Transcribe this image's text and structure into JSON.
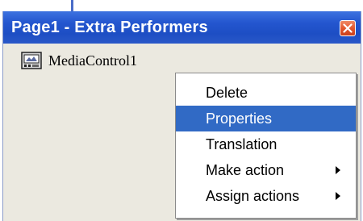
{
  "window": {
    "title": "Page1 - Extra Performers"
  },
  "component": {
    "label": "MediaControl1",
    "icon": "media-control-icon"
  },
  "context_menu": {
    "items": [
      {
        "label": "Delete",
        "selected": false,
        "has_submenu": false
      },
      {
        "label": "Properties",
        "selected": true,
        "has_submenu": false
      },
      {
        "label": "Translation",
        "selected": false,
        "has_submenu": false
      },
      {
        "label": "Make action",
        "selected": false,
        "has_submenu": true
      },
      {
        "label": "Assign actions",
        "selected": false,
        "has_submenu": true
      }
    ]
  },
  "colors": {
    "titlebar": "#2456cf",
    "selection": "#316ac5",
    "window_bg": "#ebe9e0",
    "close_button": "#e2552c"
  }
}
